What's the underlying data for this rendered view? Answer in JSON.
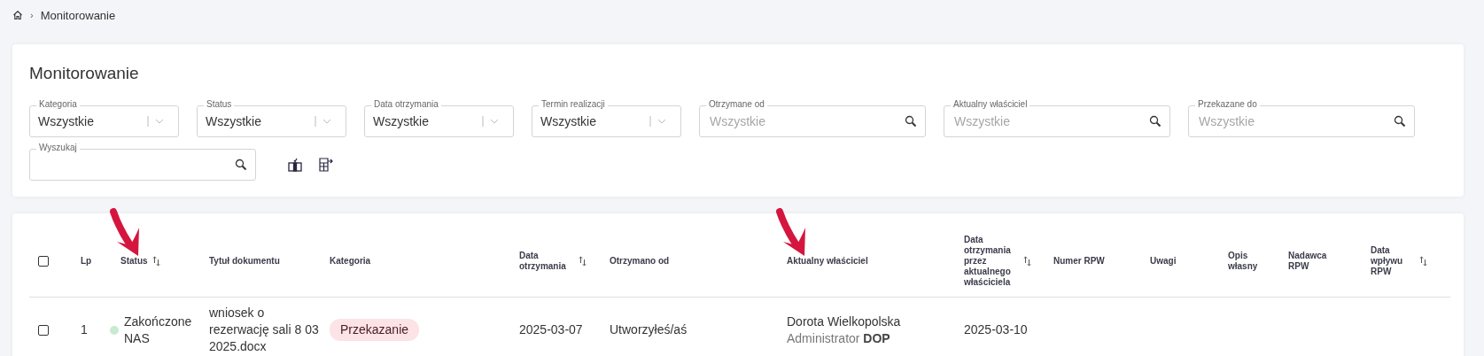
{
  "breadcrumb": {
    "separator": "›",
    "current": "Monitorowanie"
  },
  "title": "Monitorowanie",
  "filters": [
    {
      "kind": "select",
      "label": "Kategoria",
      "value": "Wszystkie"
    },
    {
      "kind": "select",
      "label": "Status",
      "value": "Wszystkie"
    },
    {
      "kind": "select",
      "label": "Data otrzymania",
      "value": "Wszystkie"
    },
    {
      "kind": "select",
      "label": "Termin realizacji",
      "value": "Wszystkie"
    },
    {
      "kind": "search",
      "label": "Otrzymane od",
      "placeholder": "Wszystkie"
    },
    {
      "kind": "search",
      "label": "Aktualny właściciel",
      "placeholder": "Wszystkie"
    },
    {
      "kind": "search",
      "label": "Przekazane do",
      "placeholder": "Wszystkie"
    },
    {
      "kind": "search",
      "label": "Wyszukaj"
    }
  ],
  "table": {
    "columns": [
      {
        "kind": "checkbox",
        "checked": false
      },
      {
        "label": "Lp",
        "sortable": false,
        "marked": false
      },
      {
        "label": "Status",
        "sortable": true,
        "marked": true
      },
      {
        "label": "Tytuł dokumentu",
        "sortable": false,
        "marked": false
      },
      {
        "label": "Kategoria",
        "sortable": false,
        "marked": false
      },
      {
        "label": "Data otrzymania",
        "sortable": true,
        "marked": false
      },
      {
        "label": "Otrzymano od",
        "sortable": false,
        "marked": false
      },
      {
        "label": "Aktualny właściciel",
        "sortable": false,
        "marked": true
      },
      {
        "label": "Data otrzymania przez aktualnego właściciela",
        "sortable": true,
        "marked": false
      },
      {
        "label": "Numer RPW",
        "sortable": false,
        "marked": false
      },
      {
        "label": "Uwagi",
        "sortable": false,
        "marked": false
      },
      {
        "label": "Opis własny",
        "sortable": false,
        "marked": false
      },
      {
        "label": "Nadawca RPW",
        "sortable": false,
        "marked": false
      },
      {
        "label": "Data wpływu RPW",
        "sortable": true,
        "marked": false
      }
    ],
    "rows": [
      {
        "checked": false,
        "lp": "1",
        "status": "Zakończone NAS",
        "color": "#c8ebcf",
        "title": "wniosek o rezerwację sali 8 03 2025.docx",
        "category": "Przekazanie",
        "received": "2025-03-07",
        "received_from": "Utworzyłeś/aś",
        "owner": "Dorota Wielkopolska",
        "owner_role": "Administrator **DOP**",
        "owner_received": "2025-03-10"
      }
    ]
  }
}
